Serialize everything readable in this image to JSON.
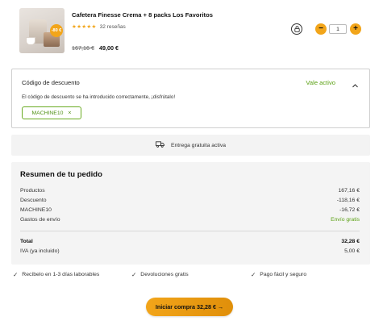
{
  "product": {
    "title": "Cafetera Finesse Crema + 8 packs Los Favoritos",
    "stars": "★★★★★",
    "reviews": "32 reseñas",
    "badge": "-80 €",
    "old_price": "167,16 €",
    "new_price": "49,00 €",
    "quantity": "1",
    "minus_label": "−",
    "plus_label": "+"
  },
  "discount": {
    "label": "Código de descuento",
    "status": "Vale activo",
    "message": "El código de descuento se ha introducido correctamente, ¡disfrútalo!",
    "code": "MACHINE10",
    "remove_label": "×"
  },
  "shipping": {
    "label": "Entrega gratuita activa"
  },
  "summary": {
    "title": "Resumen de tu pedido",
    "rows": [
      {
        "label": "Productos",
        "value": "167,16 €"
      },
      {
        "label": "Descuento",
        "value": "-118,16 €"
      },
      {
        "label": "MACHINE10",
        "value": "-16,72 €"
      },
      {
        "label": "Gastos de envío",
        "value": "Envío gratis"
      }
    ],
    "total_label": "Total",
    "total_value": "32,28 €",
    "vat_label": "IVA (ya incluido)",
    "vat_value": "5,00 €"
  },
  "features": [
    "Recíbelo en 1-3 días laborables",
    "Devoluciones gratis",
    "Pago fácil y seguro"
  ],
  "cta": {
    "label": "Iniciar compra  32,28 € →"
  },
  "colors": {
    "accent": "#f2a51a",
    "success": "#5aa012"
  }
}
